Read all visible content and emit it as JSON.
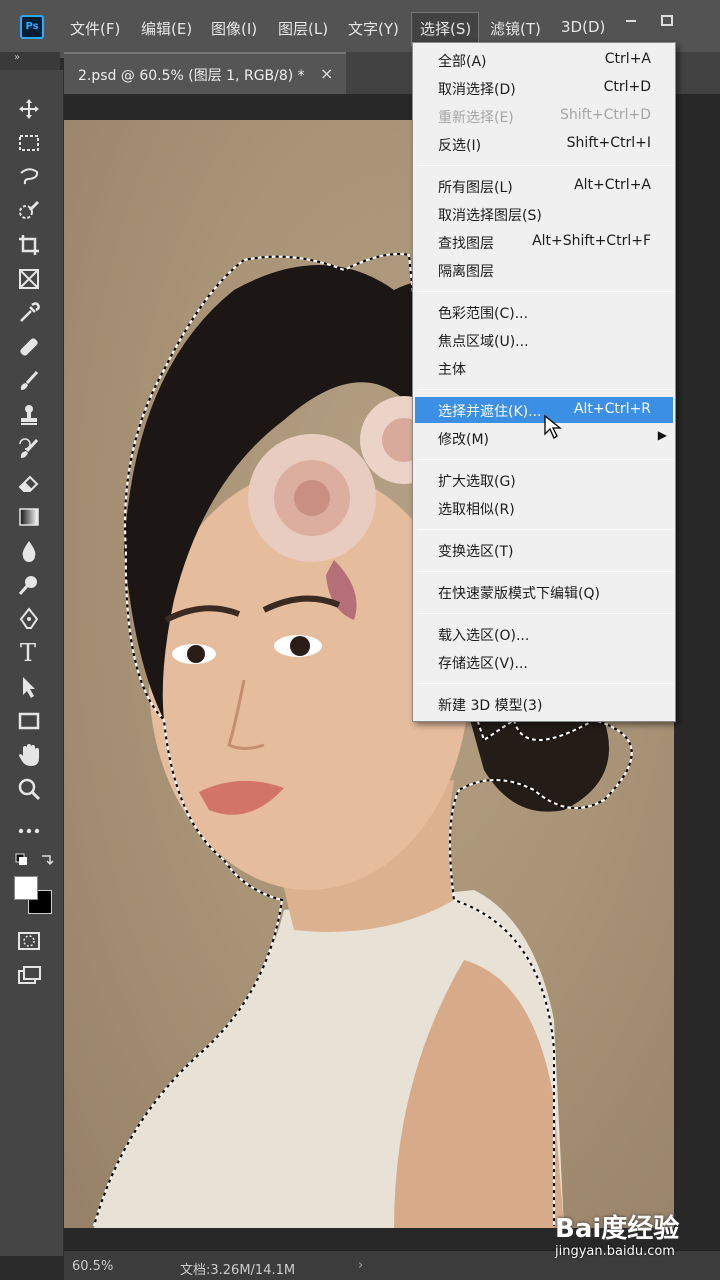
{
  "app": {
    "logo": "Ps"
  },
  "menubar": {
    "items": [
      "文件(F)",
      "编辑(E)",
      "图像(I)",
      "图层(L)",
      "文字(Y)",
      "选择(S)",
      "滤镜(T)",
      "3D(D)"
    ],
    "active": "选择(S)",
    "window_controls": [
      "minimize-icon",
      "restore-icon"
    ]
  },
  "collapse_icon": "»",
  "document_tab": {
    "label": "2.psd @ 60.5% (图层 1, RGB/8) *",
    "close": "×"
  },
  "toolbar": {
    "tools": [
      "move-tool-icon",
      "marquee-tool-icon",
      "lasso-tool-icon",
      "quick-selection-tool-icon",
      "crop-tool-icon",
      "frame-tool-icon",
      "eyedropper-tool-icon",
      "healing-brush-tool-icon",
      "brush-tool-icon",
      "clone-stamp-tool-icon",
      "history-brush-tool-icon",
      "eraser-tool-icon",
      "gradient-tool-icon",
      "blur-tool-icon",
      "dodge-tool-icon",
      "pen-tool-icon",
      "type-tool-icon",
      "path-selection-tool-icon",
      "rectangle-tool-icon",
      "hand-tool-icon",
      "zoom-tool-icon",
      "more-tools-icon"
    ],
    "type_tool_glyph": "T",
    "foreground_color": "#ffffff",
    "background_color": "#000000"
  },
  "select_menu": {
    "groups": [
      [
        {
          "label": "全部(A)",
          "shortcut": "Ctrl+A",
          "state": "normal"
        },
        {
          "label": "取消选择(D)",
          "shortcut": "Ctrl+D",
          "state": "normal"
        },
        {
          "label": "重新选择(E)",
          "shortcut": "Shift+Ctrl+D",
          "state": "disabled"
        },
        {
          "label": "反选(I)",
          "shortcut": "Shift+Ctrl+I",
          "state": "normal"
        }
      ],
      [
        {
          "label": "所有图层(L)",
          "shortcut": "Alt+Ctrl+A",
          "state": "normal"
        },
        {
          "label": "取消选择图层(S)",
          "shortcut": "",
          "state": "normal"
        },
        {
          "label": "查找图层",
          "shortcut": "Alt+Shift+Ctrl+F",
          "state": "normal"
        },
        {
          "label": "隔离图层",
          "shortcut": "",
          "state": "normal"
        }
      ],
      [
        {
          "label": "色彩范围(C)...",
          "shortcut": "",
          "state": "normal"
        },
        {
          "label": "焦点区域(U)...",
          "shortcut": "",
          "state": "normal"
        },
        {
          "label": "主体",
          "shortcut": "",
          "state": "normal"
        }
      ],
      [
        {
          "label": "选择并遮住(K)...",
          "shortcut": "Alt+Ctrl+R",
          "state": "highlight"
        },
        {
          "label": "修改(M)",
          "shortcut": "",
          "state": "submenu"
        }
      ],
      [
        {
          "label": "扩大选取(G)",
          "shortcut": "",
          "state": "normal"
        },
        {
          "label": "选取相似(R)",
          "shortcut": "",
          "state": "normal"
        }
      ],
      [
        {
          "label": "变换选区(T)",
          "shortcut": "",
          "state": "normal"
        }
      ],
      [
        {
          "label": "在快速蒙版模式下编辑(Q)",
          "shortcut": "",
          "state": "normal"
        }
      ],
      [
        {
          "label": "载入选区(O)...",
          "shortcut": "",
          "state": "normal"
        },
        {
          "label": "存储选区(V)...",
          "shortcut": "",
          "state": "normal"
        }
      ],
      [
        {
          "label": "新建 3D 模型(3)",
          "shortcut": "",
          "state": "normal"
        }
      ]
    ],
    "submenu_arrow": "▶"
  },
  "statusbar": {
    "zoom": "60.5%",
    "doc_info": "文档:3.26M/14.1M",
    "arrow": "›"
  },
  "watermark": {
    "brand": "Bai度经验",
    "url": "jingyan.baidu.com"
  }
}
